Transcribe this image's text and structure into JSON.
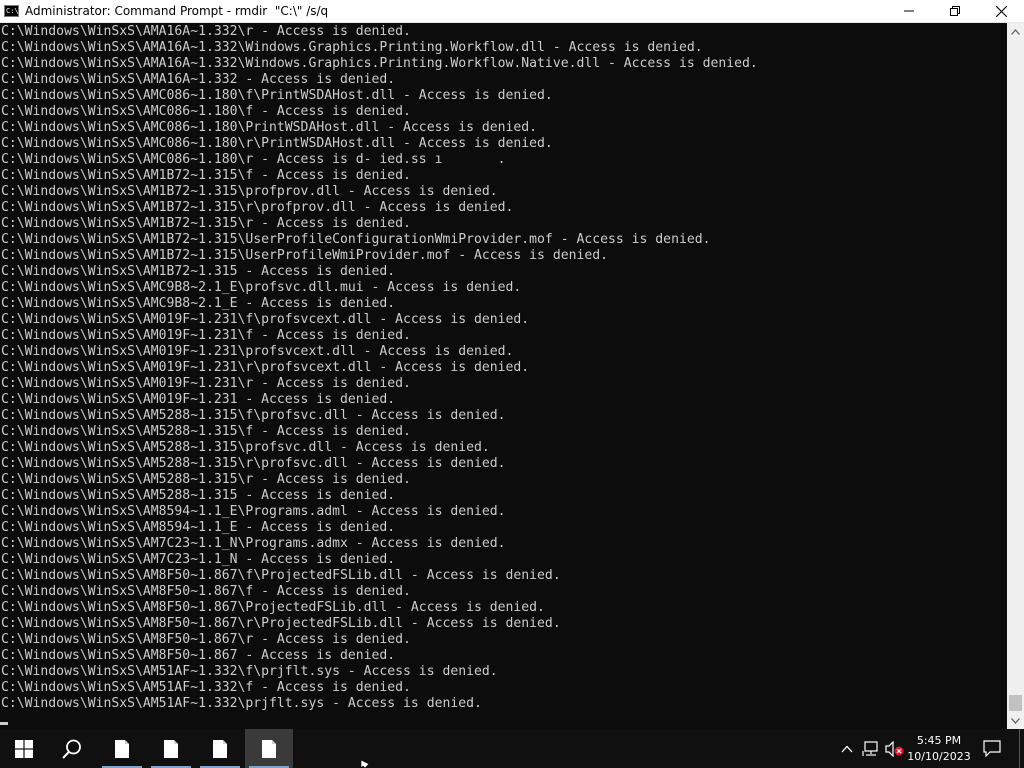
{
  "window": {
    "title": "Administrator: Command Prompt - rmdir  \"C:\\\" /s/q",
    "icon_text": "C:\\",
    "controls": {
      "minimize": "minimize-icon",
      "maximize": "restore-icon",
      "close": "close-icon"
    }
  },
  "console": {
    "lines": [
      "C:\\Windows\\WinSxS\\AMA16A~1.332\\r - Access is denied.",
      "C:\\Windows\\WinSxS\\AMA16A~1.332\\Windows.Graphics.Printing.Workflow.dll - Access is denied.",
      "C:\\Windows\\WinSxS\\AMA16A~1.332\\Windows.Graphics.Printing.Workflow.Native.dll - Access is denied.",
      "C:\\Windows\\WinSxS\\AMA16A~1.332 - Access is denied.",
      "C:\\Windows\\WinSxS\\AMC086~1.180\\f\\PrintWSDAHost.dll - Access is denied.",
      "C:\\Windows\\WinSxS\\AMC086~1.180\\f - Access is denied.",
      "C:\\Windows\\WinSxS\\AMC086~1.180\\PrintWSDAHost.dll - Access is denied.",
      "C:\\Windows\\WinSxS\\AMC086~1.180\\r\\PrintWSDAHost.dll - Access is denied.",
      "C:\\Windows\\WinSxS\\AMC086~1.180\\r - Access is d- ied.ss ı       .",
      "C:\\Windows\\WinSxS\\AM1B72~1.315\\f - Access is denied.",
      "C:\\Windows\\WinSxS\\AM1B72~1.315\\profprov.dll - Access is denied.",
      "C:\\Windows\\WinSxS\\AM1B72~1.315\\r\\profprov.dll - Access is denied.",
      "C:\\Windows\\WinSxS\\AM1B72~1.315\\r - Access is denied.",
      "C:\\Windows\\WinSxS\\AM1B72~1.315\\UserProfileConfigurationWmiProvider.mof - Access is denied.",
      "C:\\Windows\\WinSxS\\AM1B72~1.315\\UserProfileWmiProvider.mof - Access is denied.",
      "C:\\Windows\\WinSxS\\AM1B72~1.315 - Access is denied.",
      "C:\\Windows\\WinSxS\\AMC9B8~2.1_E\\profsvc.dll.mui - Access is denied.",
      "C:\\Windows\\WinSxS\\AMC9B8~2.1_E - Access is denied.",
      "C:\\Windows\\WinSxS\\AM019F~1.231\\f\\profsvcext.dll - Access is denied.",
      "C:\\Windows\\WinSxS\\AM019F~1.231\\f - Access is denied.",
      "C:\\Windows\\WinSxS\\AM019F~1.231\\profsvcext.dll - Access is denied.",
      "C:\\Windows\\WinSxS\\AM019F~1.231\\r\\profsvcext.dll - Access is denied.",
      "C:\\Windows\\WinSxS\\AM019F~1.231\\r - Access is denied.",
      "C:\\Windows\\WinSxS\\AM019F~1.231 - Access is denied.",
      "C:\\Windows\\WinSxS\\AM5288~1.315\\f\\profsvc.dll - Access is denied.",
      "C:\\Windows\\WinSxS\\AM5288~1.315\\f - Access is denied.",
      "C:\\Windows\\WinSxS\\AM5288~1.315\\profsvc.dll - Access is denied.",
      "C:\\Windows\\WinSxS\\AM5288~1.315\\r\\profsvc.dll - Access is denied.",
      "C:\\Windows\\WinSxS\\AM5288~1.315\\r - Access is denied.",
      "C:\\Windows\\WinSxS\\AM5288~1.315 - Access is denied.",
      "C:\\Windows\\WinSxS\\AM8594~1.1_E\\Programs.adml - Access is denied.",
      "C:\\Windows\\WinSxS\\AM8594~1.1_E - Access is denied.",
      "C:\\Windows\\WinSxS\\AM7C23~1.1_N\\Programs.admx - Access is denied.",
      "C:\\Windows\\WinSxS\\AM7C23~1.1_N - Access is denied.",
      "C:\\Windows\\WinSxS\\AM8F50~1.867\\f\\ProjectedFSLib.dll - Access is denied.",
      "C:\\Windows\\WinSxS\\AM8F50~1.867\\f - Access is denied.",
      "C:\\Windows\\WinSxS\\AM8F50~1.867\\ProjectedFSLib.dll - Access is denied.",
      "C:\\Windows\\WinSxS\\AM8F50~1.867\\r\\ProjectedFSLib.dll - Access is denied.",
      "C:\\Windows\\WinSxS\\AM8F50~1.867\\r - Access is denied.",
      "C:\\Windows\\WinSxS\\AM8F50~1.867 - Access is denied.",
      "C:\\Windows\\WinSxS\\AM51AF~1.332\\f\\prjflt.sys - Access is denied.",
      "C:\\Windows\\WinSxS\\AM51AF~1.332\\f - Access is denied.",
      "C:\\Windows\\WinSxS\\AM51AF~1.332\\prjflt.sys - Access is denied."
    ],
    "background": "#0c0c0c",
    "foreground": "#cccccc"
  },
  "scrollbar": {
    "position": 0.97
  },
  "taskbar": {
    "start_icon": "windows-logo-icon",
    "search_icon": "search-icon",
    "apps": [
      {
        "icon": "document-icon",
        "active": false
      },
      {
        "icon": "document-icon",
        "active": false
      },
      {
        "icon": "document-icon",
        "active": false
      },
      {
        "icon": "document-icon",
        "active": true
      }
    ],
    "tray": {
      "chevron_icon": "chevron-up-icon",
      "network_icon": "network-icon",
      "volume_icon": "volume-muted-icon",
      "notifications_icon": "notification-icon"
    },
    "clock": {
      "time": "5:45 PM",
      "date": "10/10/2023"
    }
  },
  "colors": {
    "taskbar": "#101010",
    "accent_underline": "#7aa6d6",
    "titlebar": "#ffffff"
  }
}
